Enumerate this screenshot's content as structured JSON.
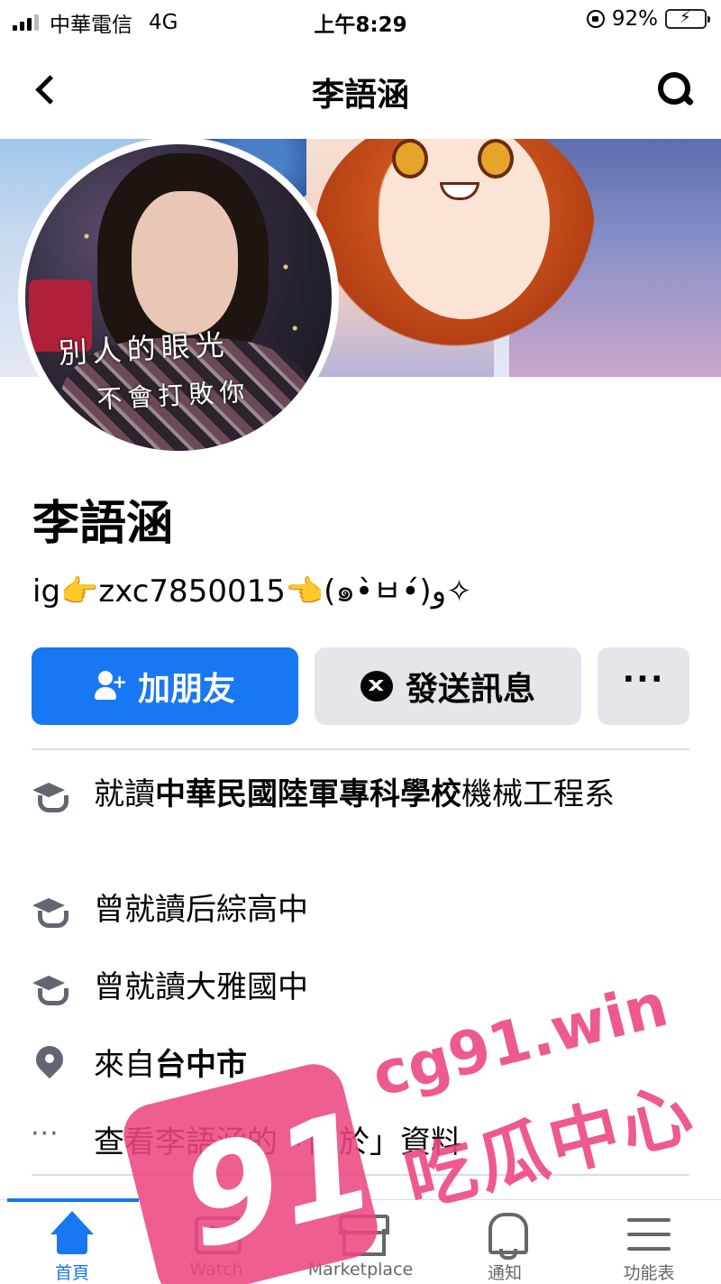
{
  "status_bar": {
    "carrier": "中華電信",
    "network": "4G",
    "time": "上午8:29",
    "battery": "92%"
  },
  "header": {
    "title": "李語涵"
  },
  "cover": {
    "avatar_caption_line1": "別人的眼光",
    "avatar_caption_line2": "不會打敗你"
  },
  "profile": {
    "name": "李語涵",
    "bio": "ig👉zxc7850015👈(๑•̀ㅂ•́)و✧"
  },
  "actions": {
    "add_friend_label": "加朋友",
    "message_label": "發送訊息",
    "more_label": "···"
  },
  "info": [
    {
      "icon": "graduation-cap-icon",
      "prefix": "就讀",
      "bold": "中華民國陸軍專科學校",
      "suffix": "機械工程系"
    },
    {
      "icon": "graduation-cap-icon",
      "prefix": "曾就讀后綜高中",
      "bold": "",
      "suffix": ""
    },
    {
      "icon": "graduation-cap-icon",
      "prefix": "曾就讀大雅國中",
      "bold": "",
      "suffix": ""
    },
    {
      "icon": "location-pin-icon",
      "prefix": "來自",
      "bold": "台中市",
      "suffix": ""
    },
    {
      "icon": "more-dots-icon",
      "prefix": "查看李語涵的「關於」資料",
      "bold": "",
      "suffix": ""
    }
  ],
  "tabs": [
    {
      "label": "首頁",
      "icon": "home-icon",
      "active": true
    },
    {
      "label": "Watch",
      "icon": "watch-icon",
      "active": false
    },
    {
      "label": "Marketplace",
      "icon": "marketplace-icon",
      "active": false
    },
    {
      "label": "通知",
      "icon": "bell-icon",
      "active": false
    },
    {
      "label": "功能表",
      "icon": "menu-icon",
      "active": false
    }
  ],
  "watermark": {
    "badge": "91",
    "url": "cg91.win",
    "text": "吃瓜中心"
  },
  "colors": {
    "accent": "#1877f2",
    "secondary_button": "#e4e6eb",
    "icon_gray": "#606770",
    "watermark": "#ec4882"
  }
}
